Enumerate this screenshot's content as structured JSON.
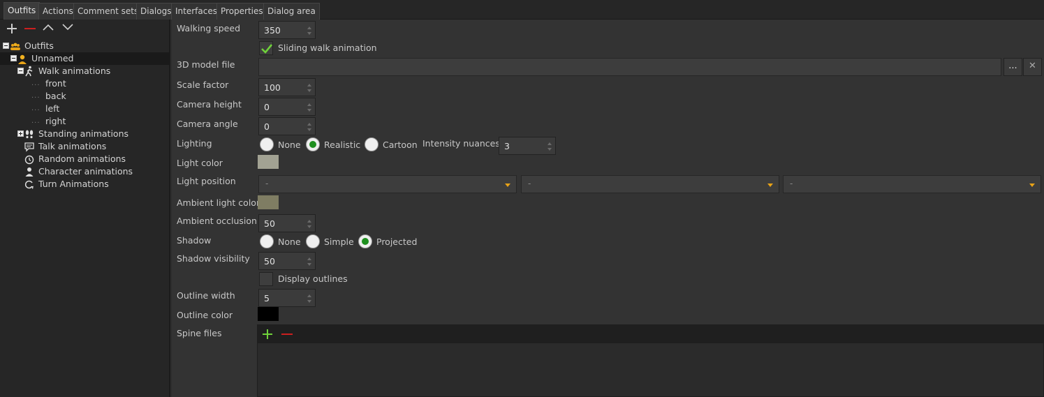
{
  "tabs": [
    {
      "label": "Outfits",
      "active": true
    },
    {
      "label": "Actions"
    },
    {
      "label": "Comment sets"
    },
    {
      "label": "Dialogs"
    },
    {
      "label": "Interfaces"
    },
    {
      "label": "Properties"
    },
    {
      "label": "Dialog area"
    }
  ],
  "tree": {
    "root": "Outfits",
    "outfit": "Unnamed",
    "walk": "Walk animations",
    "walk_children": [
      "front",
      "back",
      "left",
      "right"
    ],
    "standing": "Standing animations",
    "talk": "Talk animations",
    "random": "Random animations",
    "character": "Character animations",
    "turn": "Turn Animations"
  },
  "form": {
    "walking_speed": {
      "label": "Walking speed",
      "value": "350"
    },
    "sliding_walk": {
      "label": "Sliding walk animation",
      "checked": true
    },
    "model_file": {
      "label": "3D model file",
      "value": "",
      "browse": "...",
      "clear": "✕"
    },
    "scale_factor": {
      "label": "Scale factor",
      "value": "100"
    },
    "camera_height": {
      "label": "Camera height",
      "value": "0"
    },
    "camera_angle": {
      "label": "Camera angle",
      "value": "0"
    },
    "lighting": {
      "label": "Lighting",
      "options": [
        "None",
        "Realistic",
        "Cartoon"
      ],
      "selected": "Realistic"
    },
    "intensity_nuances": {
      "label": "Intensity nuances",
      "value": "3"
    },
    "light_color": {
      "label": "Light color",
      "color": "#a2a293"
    },
    "light_position": {
      "label": "Light position",
      "values": [
        "-",
        "-",
        "-"
      ]
    },
    "ambient_light_color": {
      "label": "Ambient light color",
      "color": "#7f7d63"
    },
    "ambient_occlusion": {
      "label": "Ambient occlusion",
      "value": "50"
    },
    "shadow": {
      "label": "Shadow",
      "options": [
        "None",
        "Simple",
        "Projected"
      ],
      "selected": "Projected"
    },
    "shadow_visibility": {
      "label": "Shadow visibility",
      "value": "50"
    },
    "display_outlines": {
      "label": "Display outlines",
      "checked": false
    },
    "outline_width": {
      "label": "Outline width",
      "value": "5"
    },
    "outline_color": {
      "label": "Outline color",
      "color": "#000000"
    },
    "spine_files": {
      "label": "Spine files"
    }
  },
  "colors": {
    "accent_green": "#1e8f1e",
    "remove_red": "#cc1f1f",
    "caret_orange": "#e8a317"
  }
}
